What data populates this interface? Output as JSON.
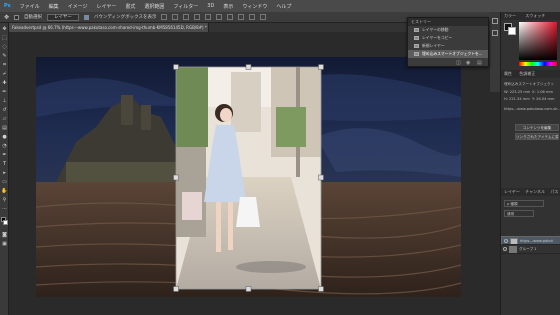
{
  "menubar": {
    "items": [
      "Ps",
      "ファイル",
      "編集",
      "イメージ",
      "レイヤー",
      "書式",
      "選択範囲",
      "フィルター",
      "3D",
      "表示",
      "ウィンドウ",
      "ヘルプ"
    ]
  },
  "options": {
    "auto_select_label": "自動選択",
    "auto_select_value": "レイヤー",
    "transform_label": "バウンディングボックスを表示"
  },
  "document": {
    "tab_title": "Fakeadvertpsd @ 66.7% (https---www.pakutaso.com-shared-img-thumb-KM5856145D, RGB/8#) *"
  },
  "history": {
    "title": "ヒストリー",
    "items": [
      {
        "label": "レイヤーの移動",
        "active": false
      },
      {
        "label": "レイヤーをコピー",
        "active": false
      },
      {
        "label": "新規レイヤー",
        "active": false
      },
      {
        "label": "埋め込みスマートオブジェクトを...",
        "active": true
      }
    ]
  },
  "color_panel": {
    "title": "カラー",
    "tab2": "スウォッチ"
  },
  "properties": {
    "title": "属性",
    "tab2": "色調補正",
    "subtitle": "埋め込みスマートオブジェクト",
    "w": "W: 223.25 mm",
    "h": "H: 221.34 mm",
    "x": "X: 1.06 mm",
    "y": "Y: 26.04 mm",
    "link": "https---www.pakutaso.com-sh...",
    "btn1": "コンテンツを編集",
    "btn2": "リンクされたアイテムに変換"
  },
  "layers": {
    "tabs": [
      "レイヤー",
      "チャンネル",
      "パス"
    ],
    "kind": "ρ 種類",
    "blend": "通常",
    "rows": [
      {
        "name": "https---www.pakut",
        "selected": true
      },
      {
        "name": "グループ 1",
        "selected": false
      }
    ]
  },
  "colors": {
    "accent": "#4d5a66",
    "panel": "#323232",
    "menubar": "#4a4a4a"
  }
}
